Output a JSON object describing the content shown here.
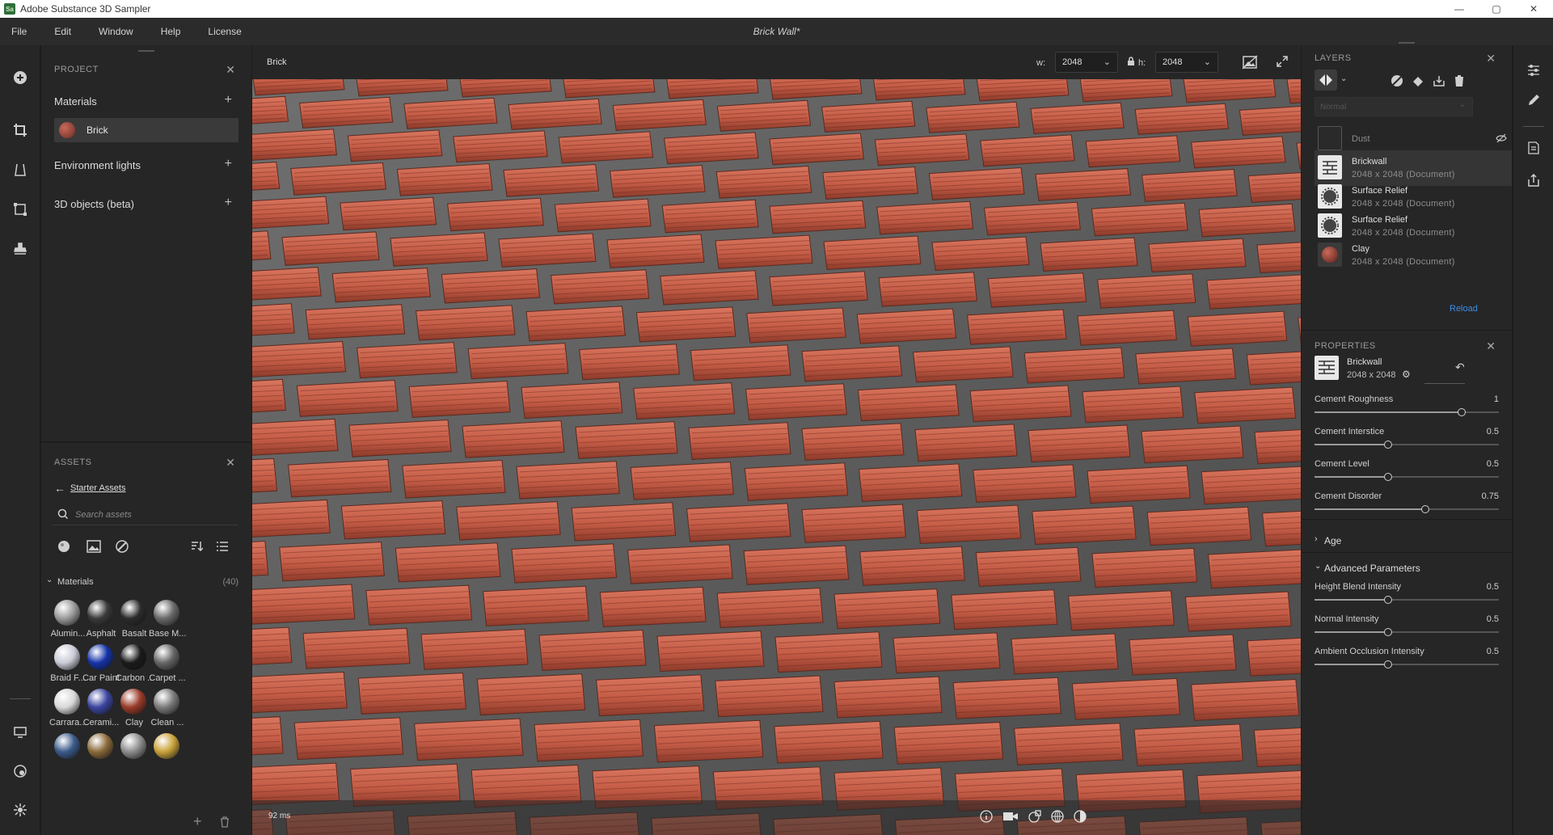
{
  "window": {
    "app_icon": "Sa",
    "title": "Adobe Substance 3D Sampler",
    "minimize": "—",
    "maximize": "▢",
    "close": "✕"
  },
  "menu": {
    "items": [
      "File",
      "Edit",
      "Window",
      "Help",
      "License"
    ],
    "document_title": "Brick Wall*"
  },
  "project": {
    "header": "PROJECT",
    "materials_label": "Materials",
    "active_material": "Brick",
    "env_lights_label": "Environment lights",
    "objects_label": "3D objects (beta)"
  },
  "assets": {
    "header": "ASSETS",
    "breadcrumb": "Starter Assets",
    "search_placeholder": "Search assets",
    "group_label": "Materials",
    "group_count": "(40)",
    "items": [
      {
        "label": "Alumin...",
        "color": "#9a9a9a"
      },
      {
        "label": "Asphalt",
        "color": "#3a3a3a"
      },
      {
        "label": "Basalt",
        "color": "#2c2c2c"
      },
      {
        "label": "Base M...",
        "color": "#6a6a6a"
      },
      {
        "label": "Braid F...",
        "color": "#c9cbd6"
      },
      {
        "label": "Car Paint",
        "color": "#1533a8"
      },
      {
        "label": "Carbon ...",
        "color": "#1a1a1a"
      },
      {
        "label": "Carpet ...",
        "color": "#666666"
      },
      {
        "label": "Carrara...",
        "color": "#d8d8d8"
      },
      {
        "label": "Cerami...",
        "color": "#3b45a0"
      },
      {
        "label": "Clay",
        "color": "#9a3b28"
      },
      {
        "label": "Clean ...",
        "color": "#7a7a7a"
      },
      {
        "label": "",
        "color": "#3b5a8a"
      },
      {
        "label": "",
        "color": "#8a6a3a"
      },
      {
        "label": "",
        "color": "#8c8c8c"
      },
      {
        "label": "",
        "color": "#c9a23a"
      }
    ]
  },
  "viewport": {
    "tab_label": "Brick",
    "w_label": "w:",
    "w_value": "2048",
    "h_label": "h:",
    "h_value": "2048",
    "render_time": "92 ms"
  },
  "layers": {
    "header": "LAYERS",
    "blend_mode": "Normal",
    "items": [
      {
        "name": "Dust",
        "detail": ""
      },
      {
        "name": "Brickwall",
        "detail": "2048 x 2048 (Document)"
      },
      {
        "name": "Surface Relief",
        "detail": "2048 x 2048 (Document)"
      },
      {
        "name": "Surface Relief",
        "detail": "2048 x 2048 (Document)"
      },
      {
        "name": "Clay",
        "detail": "2048 x 2048 (Document)"
      }
    ],
    "reload_label": "Reload"
  },
  "properties": {
    "header": "PROPERTIES",
    "layer_name": "Brickwall",
    "layer_size": "2048 x 2048",
    "sliders": [
      {
        "label": "Cement Roughness",
        "value": "1",
        "fraction": 1.0
      },
      {
        "label": "Cement Interstice",
        "value": "0.5",
        "fraction": 0.5
      },
      {
        "label": "Cement Level",
        "value": "0.5",
        "fraction": 0.5
      },
      {
        "label": "Cement Disorder",
        "value": "0.75",
        "fraction": 0.75
      }
    ],
    "age_label": "Age",
    "advanced_label": "Advanced Parameters",
    "advanced_sliders": [
      {
        "label": "Height Blend Intensity",
        "value": "0.5",
        "fraction": 0.5
      },
      {
        "label": "Normal Intensity",
        "value": "0.5",
        "fraction": 0.5
      },
      {
        "label": "Ambient Occlusion Intensity",
        "value": "0.5",
        "fraction": 0.5
      }
    ]
  }
}
